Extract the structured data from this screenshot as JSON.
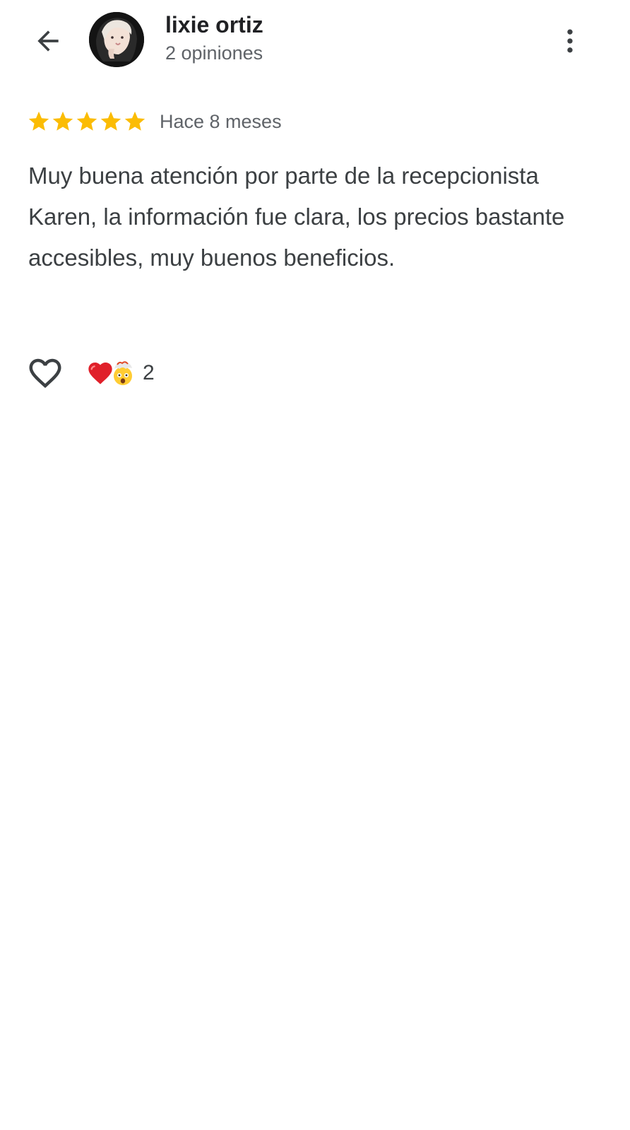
{
  "header": {
    "reviewer_name": "lixie ortiz",
    "reviewer_review_count": "2 opiniones",
    "back_icon": "arrow-back-icon",
    "more_icon": "more-vert-icon",
    "avatar": "avatar-photo"
  },
  "review": {
    "rating": 5,
    "rating_max": 5,
    "star_color": "#fbbc04",
    "date": "Hace 8 meses",
    "text": "Muy buena atención por parte de la recepcionista Karen, la información fue clara, los precios bastante accesibles, muy buenos beneficios."
  },
  "actions": {
    "like_icon": "heart-outline-icon",
    "reaction_icons": [
      "red-heart-emoji",
      "exploding-head-emoji"
    ],
    "reaction_count": "2"
  }
}
